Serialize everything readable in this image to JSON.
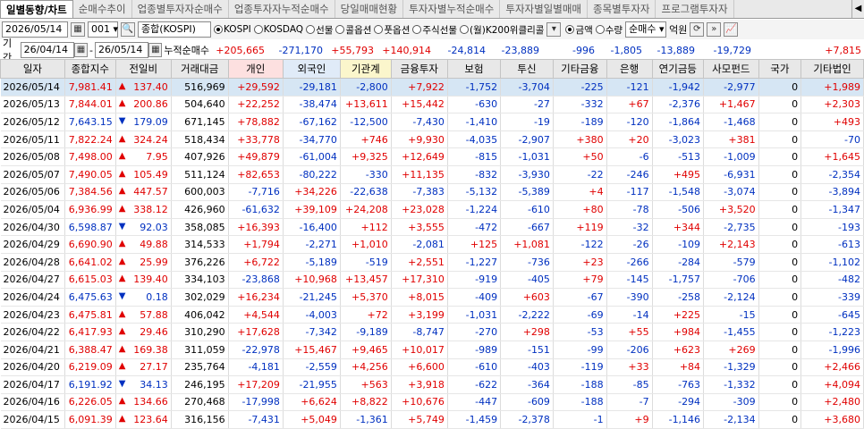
{
  "tabs": [
    "일별동향/차트",
    "순매수추이",
    "업종별투자자순매수",
    "업종투자자누적순매수",
    "당일매매현황",
    "투자자별누적순매수",
    "투자자별일별매매",
    "종목별투자자",
    "프로그램투자자"
  ],
  "toolbar": {
    "date": "2026/05/14",
    "code": "001",
    "index_name": "종합(KOSPI)",
    "markets": [
      {
        "label": "KOSPI",
        "on": true
      },
      {
        "label": "KOSDAQ",
        "on": false
      },
      {
        "label": "선물",
        "on": false
      },
      {
        "label": "콜옵션",
        "on": false
      },
      {
        "label": "풋옵션",
        "on": false
      },
      {
        "label": "주식선물",
        "on": false
      },
      {
        "label": "(월)K200위클리콜",
        "on": false
      }
    ],
    "units": [
      {
        "label": "금액",
        "on": true
      },
      {
        "label": "수량",
        "on": false
      }
    ],
    "mode": "순매수",
    "unit_label": "억원"
  },
  "period": {
    "label": "기간",
    "from": "26/04/14",
    "to": "26/05/14",
    "cumulative_label": "누적순매수",
    "sums": [
      "+205,665",
      "-271,170",
      "+55,793",
      "+140,914",
      "-24,814",
      "-23,889",
      "-996",
      "-1,805",
      "-13,889",
      "-19,729",
      "",
      "+7,815"
    ]
  },
  "columns": [
    "일자",
    "종합지수",
    "전일비",
    "거래대금",
    "개인",
    "외국인",
    "기관계",
    "금융투자",
    "보험",
    "투신",
    "기타금융",
    "은행",
    "연기금등",
    "사모펀드",
    "국가",
    "기타법인"
  ],
  "rows": [
    [
      "2026/05/14",
      "7,981.41",
      "up",
      "137.40",
      "516,969",
      "+29,592",
      "-29,181",
      "-2,800",
      "+7,922",
      "-1,752",
      "-3,704",
      "-225",
      "-121",
      "-1,942",
      "-2,977",
      "0",
      "+1,989"
    ],
    [
      "2026/05/13",
      "7,844.01",
      "up",
      "200.86",
      "504,640",
      "+22,252",
      "-38,474",
      "+13,611",
      "+15,442",
      "-630",
      "-27",
      "-332",
      "+67",
      "-2,376",
      "+1,467",
      "0",
      "+2,303"
    ],
    [
      "2026/05/12",
      "7,643.15",
      "dn",
      "179.09",
      "671,145",
      "+78,882",
      "-67,162",
      "-12,500",
      "-7,430",
      "-1,410",
      "-19",
      "-189",
      "-120",
      "-1,864",
      "-1,468",
      "0",
      "+493"
    ],
    [
      "2026/05/11",
      "7,822.24",
      "up",
      "324.24",
      "518,434",
      "+33,778",
      "-34,770",
      "+746",
      "+9,930",
      "-4,035",
      "-2,907",
      "+380",
      "+20",
      "-3,023",
      "+381",
      "0",
      "-70"
    ],
    [
      "2026/05/08",
      "7,498.00",
      "up",
      "7.95",
      "407,926",
      "+49,879",
      "-61,004",
      "+9,325",
      "+12,649",
      "-815",
      "-1,031",
      "+50",
      "-6",
      "-513",
      "-1,009",
      "0",
      "+1,645"
    ],
    [
      "2026/05/07",
      "7,490.05",
      "up",
      "105.49",
      "511,124",
      "+82,653",
      "-80,222",
      "-330",
      "+11,135",
      "-832",
      "-3,930",
      "-22",
      "-246",
      "+495",
      "-6,931",
      "0",
      "-2,354"
    ],
    [
      "2026/05/06",
      "7,384.56",
      "up",
      "447.57",
      "600,003",
      "-7,716",
      "+34,226",
      "-22,638",
      "-7,383",
      "-5,132",
      "-5,389",
      "+4",
      "-117",
      "-1,548",
      "-3,074",
      "0",
      "-3,894"
    ],
    [
      "2026/05/04",
      "6,936.99",
      "up",
      "338.12",
      "426,960",
      "-61,632",
      "+39,109",
      "+24,208",
      "+23,028",
      "-1,224",
      "-610",
      "+80",
      "-78",
      "-506",
      "+3,520",
      "0",
      "-1,347"
    ],
    [
      "2026/04/30",
      "6,598.87",
      "dn",
      "92.03",
      "358,085",
      "+16,393",
      "-16,400",
      "+112",
      "+3,555",
      "-472",
      "-667",
      "+119",
      "-32",
      "+344",
      "-2,735",
      "0",
      "-193"
    ],
    [
      "2026/04/29",
      "6,690.90",
      "up",
      "49.88",
      "314,533",
      "+1,794",
      "-2,271",
      "+1,010",
      "-2,081",
      "+125",
      "+1,081",
      "-122",
      "-26",
      "-109",
      "+2,143",
      "0",
      "-613"
    ],
    [
      "2026/04/28",
      "6,641.02",
      "up",
      "25.99",
      "376,226",
      "+6,722",
      "-5,189",
      "-519",
      "+2,551",
      "-1,227",
      "-736",
      "+23",
      "-266",
      "-284",
      "-579",
      "0",
      "-1,102"
    ],
    [
      "2026/04/27",
      "6,615.03",
      "up",
      "139.40",
      "334,103",
      "-23,868",
      "+10,968",
      "+13,457",
      "+17,310",
      "-919",
      "-405",
      "+79",
      "-145",
      "-1,757",
      "-706",
      "0",
      "-482"
    ],
    [
      "2026/04/24",
      "6,475.63",
      "dn",
      "0.18",
      "302,029",
      "+16,234",
      "-21,245",
      "+5,370",
      "+8,015",
      "-409",
      "+603",
      "-67",
      "-390",
      "-258",
      "-2,124",
      "0",
      "-339"
    ],
    [
      "2026/04/23",
      "6,475.81",
      "up",
      "57.88",
      "406,042",
      "+4,544",
      "-4,003",
      "+72",
      "+3,199",
      "-1,031",
      "-2,222",
      "-69",
      "-14",
      "+225",
      "-15",
      "0",
      "-645"
    ],
    [
      "2026/04/22",
      "6,417.93",
      "up",
      "29.46",
      "310,290",
      "+17,628",
      "-7,342",
      "-9,189",
      "-8,747",
      "-270",
      "+298",
      "-53",
      "+55",
      "+984",
      "-1,455",
      "0",
      "-1,223"
    ],
    [
      "2026/04/21",
      "6,388.47",
      "up",
      "169.38",
      "311,059",
      "-22,978",
      "+15,467",
      "+9,465",
      "+10,017",
      "-989",
      "-151",
      "-99",
      "-206",
      "+623",
      "+269",
      "0",
      "-1,996"
    ],
    [
      "2026/04/20",
      "6,219.09",
      "up",
      "27.17",
      "235,764",
      "-4,181",
      "-2,559",
      "+4,256",
      "+6,600",
      "-610",
      "-403",
      "-119",
      "+33",
      "+84",
      "-1,329",
      "0",
      "+2,466"
    ],
    [
      "2026/04/17",
      "6,191.92",
      "dn",
      "34.13",
      "246,195",
      "+17,209",
      "-21,955",
      "+563",
      "+3,918",
      "-622",
      "-364",
      "-188",
      "-85",
      "-763",
      "-1,332",
      "0",
      "+4,094"
    ],
    [
      "2026/04/16",
      "6,226.05",
      "up",
      "134.66",
      "270,468",
      "-17,998",
      "+6,624",
      "+8,822",
      "+10,676",
      "-447",
      "-609",
      "-188",
      "-7",
      "-294",
      "-309",
      "0",
      "+2,480"
    ],
    [
      "2026/04/15",
      "6,091.39",
      "up",
      "123.64",
      "316,156",
      "-7,431",
      "+5,049",
      "-1,361",
      "+5,749",
      "-1,459",
      "-2,378",
      "-1",
      "+9",
      "-1,146",
      "-2,134",
      "0",
      "+3,680"
    ]
  ],
  "colors": {
    "positive": "#e00000",
    "negative": "#0030c0",
    "selected_row": "#d6e6f4"
  }
}
